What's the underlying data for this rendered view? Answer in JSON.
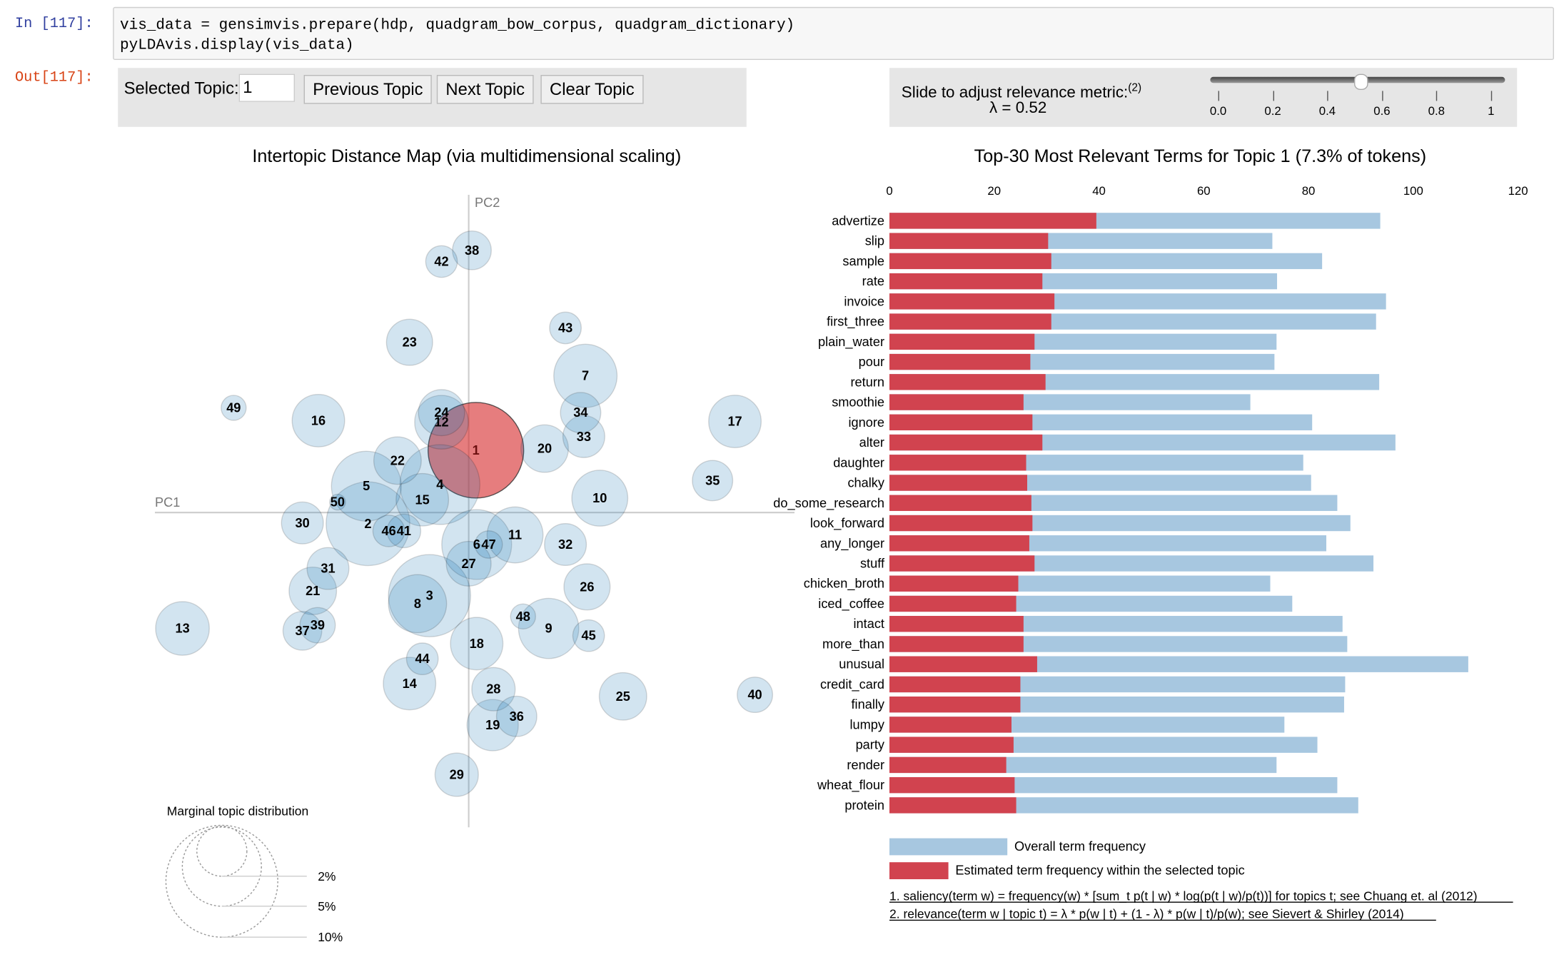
{
  "notebook": {
    "in_prompt": "In [117]:",
    "out_prompt": "Out[117]:",
    "code_lines": [
      "vis_data = gensimvis.prepare(hdp, quadgram_bow_corpus, quadgram_dictionary)",
      "pyLDAvis.display(vis_data)"
    ]
  },
  "controls": {
    "selected_topic_label": "Selected Topic:",
    "selected_topic_value": "1",
    "previous_label": "Previous Topic",
    "next_label": "Next Topic",
    "clear_label": "Clear Topic"
  },
  "slider": {
    "label": "Slide to adjust relevance metric:",
    "footnote_ref": "(2)",
    "lambda_text": "λ = 0.52",
    "value": 0.52,
    "ticks": [
      "0.0",
      "0.2",
      "0.4",
      "0.6",
      "0.8",
      "1"
    ]
  },
  "colors": {
    "topic_fill": "#1f77b4",
    "selected_topic_fill": "#d62728",
    "overall_bar": "#a7c7e0",
    "topic_bar": "#d1434f"
  },
  "chart_data": [
    {
      "type": "scatter",
      "title": "Intertopic Distance Map (via multidimensional scaling)",
      "xlabel": "PC1",
      "ylabel": "PC2",
      "selected_topic": 1,
      "size_legend": {
        "title": "Marginal topic distribution",
        "levels": [
          {
            "label": "2%",
            "value": 2
          },
          {
            "label": "5%",
            "value": 5
          },
          {
            "label": "10%",
            "value": 10
          }
        ]
      },
      "topics": [
        {
          "id": "1",
          "pc1": 0.009,
          "pc2": 0.078,
          "pct": 7.3
        },
        {
          "id": "2",
          "pc1": -0.126,
          "pc2": -0.014,
          "pct": 5.6
        },
        {
          "id": "3",
          "pc1": -0.049,
          "pc2": -0.104,
          "pct": 5.4
        },
        {
          "id": "4",
          "pc1": -0.036,
          "pc2": 0.035,
          "pct": 5.1
        },
        {
          "id": "5",
          "pc1": -0.128,
          "pc2": 0.033,
          "pct": 3.9
        },
        {
          "id": "6",
          "pc1": 0.01,
          "pc2": -0.04,
          "pct": 3.9
        },
        {
          "id": "7",
          "pc1": 0.146,
          "pc2": 0.171,
          "pct": 3.2
        },
        {
          "id": "8",
          "pc1": -0.064,
          "pc2": -0.114,
          "pct": 2.7
        },
        {
          "id": "9",
          "pc1": 0.1,
          "pc2": -0.145,
          "pct": 2.9
        },
        {
          "id": "10",
          "pc1": 0.164,
          "pc2": 0.018,
          "pct": 2.5
        },
        {
          "id": "11",
          "pc1": 0.058,
          "pc2": -0.028,
          "pct": 2.5
        },
        {
          "id": "12",
          "pc1": -0.034,
          "pc2": 0.113,
          "pct": 2.3
        },
        {
          "id": "13",
          "pc1": -0.358,
          "pc2": -0.145,
          "pct": 2.3
        },
        {
          "id": "14",
          "pc1": -0.074,
          "pc2": -0.214,
          "pct": 2.2
        },
        {
          "id": "15",
          "pc1": -0.058,
          "pc2": 0.016,
          "pct": 2.2
        },
        {
          "id": "16",
          "pc1": -0.188,
          "pc2": 0.115,
          "pct": 2.2
        },
        {
          "id": "17",
          "pc1": 0.333,
          "pc2": 0.114,
          "pct": 2.2
        },
        {
          "id": "18",
          "pc1": 0.01,
          "pc2": -0.164,
          "pct": 2.2
        },
        {
          "id": "19",
          "pc1": 0.03,
          "pc2": -0.266,
          "pct": 2.1
        },
        {
          "id": "20",
          "pc1": 0.095,
          "pc2": 0.08,
          "pct": 1.8
        },
        {
          "id": "21",
          "pc1": -0.195,
          "pc2": -0.098,
          "pct": 1.8
        },
        {
          "id": "22",
          "pc1": -0.089,
          "pc2": 0.065,
          "pct": 1.8
        },
        {
          "id": "23",
          "pc1": -0.074,
          "pc2": 0.213,
          "pct": 1.7
        },
        {
          "id": "24",
          "pc1": -0.034,
          "pc2": 0.125,
          "pct": 1.7
        },
        {
          "id": "25",
          "pc1": 0.193,
          "pc2": -0.23,
          "pct": 1.8
        },
        {
          "id": "26",
          "pc1": 0.148,
          "pc2": -0.093,
          "pct": 1.7
        },
        {
          "id": "27",
          "pc1": 0.0,
          "pc2": -0.064,
          "pct": 1.6
        },
        {
          "id": "28",
          "pc1": 0.031,
          "pc2": -0.221,
          "pct": 1.5
        },
        {
          "id": "29",
          "pc1": -0.015,
          "pc2": -0.328,
          "pct": 1.5
        },
        {
          "id": "30",
          "pc1": -0.208,
          "pc2": -0.013,
          "pct": 1.4
        },
        {
          "id": "31",
          "pc1": -0.176,
          "pc2": -0.07,
          "pct": 1.4
        },
        {
          "id": "32",
          "pc1": 0.121,
          "pc2": -0.04,
          "pct": 1.4
        },
        {
          "id": "33",
          "pc1": 0.144,
          "pc2": 0.095,
          "pct": 1.4
        },
        {
          "id": "34",
          "pc1": 0.14,
          "pc2": 0.125,
          "pct": 1.3
        },
        {
          "id": "35",
          "pc1": 0.305,
          "pc2": 0.04,
          "pct": 1.3
        },
        {
          "id": "36",
          "pc1": 0.06,
          "pc2": -0.255,
          "pct": 1.3
        },
        {
          "id": "37",
          "pc1": -0.208,
          "pc2": -0.148,
          "pct": 1.2
        },
        {
          "id": "38",
          "pc1": 0.004,
          "pc2": 0.328,
          "pct": 1.2
        },
        {
          "id": "39",
          "pc1": -0.189,
          "pc2": -0.141,
          "pct": 1.0
        },
        {
          "id": "40",
          "pc1": 0.358,
          "pc2": -0.228,
          "pct": 1.0
        },
        {
          "id": "41",
          "pc1": -0.081,
          "pc2": -0.023,
          "pct": 0.9
        },
        {
          "id": "42",
          "pc1": -0.034,
          "pc2": 0.314,
          "pct": 0.8
        },
        {
          "id": "43",
          "pc1": 0.121,
          "pc2": 0.231,
          "pct": 0.8
        },
        {
          "id": "44",
          "pc1": -0.058,
          "pc2": -0.183,
          "pct": 0.8
        },
        {
          "id": "45",
          "pc1": 0.15,
          "pc2": -0.154,
          "pct": 0.8
        },
        {
          "id": "46",
          "pc1": -0.1,
          "pc2": -0.023,
          "pct": 0.8
        },
        {
          "id": "47",
          "pc1": 0.025,
          "pc2": -0.04,
          "pct": 0.6
        },
        {
          "id": "48",
          "pc1": 0.068,
          "pc2": -0.13,
          "pct": 0.5
        },
        {
          "id": "49",
          "pc1": -0.294,
          "pc2": 0.131,
          "pct": 0.5
        },
        {
          "id": "50",
          "pc1": -0.164,
          "pc2": 0.013,
          "pct": 0.2
        }
      ]
    },
    {
      "type": "bar",
      "orientation": "horizontal",
      "title": "Top-30 Most Relevant Terms for Topic 1 (7.3% of tokens)",
      "xlim": [
        0,
        120
      ],
      "xticks": [
        "0",
        "20",
        "40",
        "60",
        "80",
        "100",
        "120"
      ],
      "categories": [
        "advertize",
        "slip",
        "sample",
        "rate",
        "invoice",
        "first_three",
        "plain_water",
        "pour",
        "return",
        "smoothie",
        "ignore",
        "alter",
        "daughter",
        "chalky",
        "do_some_research",
        "look_forward",
        "any_longer",
        "stuff",
        "chicken_broth",
        "iced_coffee",
        "intact",
        "more_than",
        "unusual",
        "credit_card",
        "finally",
        "lumpy",
        "party",
        "render",
        "wheat_flour",
        "protein"
      ],
      "series": [
        {
          "name": "Overall term frequency",
          "values": [
            93.7,
            73.1,
            82.6,
            74.0,
            94.8,
            92.9,
            73.9,
            73.5,
            93.5,
            68.9,
            80.7,
            96.6,
            79.0,
            80.5,
            85.5,
            88.0,
            83.4,
            92.4,
            72.7,
            76.9,
            86.5,
            87.4,
            110.5,
            87.0,
            86.8,
            75.4,
            81.7,
            73.9,
            85.5,
            89.5
          ]
        },
        {
          "name": "Estimated term frequency within the selected topic",
          "values": [
            39.5,
            30.3,
            30.9,
            29.2,
            31.5,
            30.9,
            27.7,
            26.9,
            29.8,
            25.6,
            27.3,
            29.2,
            26.1,
            26.3,
            27.1,
            27.3,
            26.7,
            27.7,
            24.6,
            24.2,
            25.6,
            25.6,
            28.2,
            25.0,
            25.0,
            23.3,
            23.7,
            22.3,
            23.9,
            24.2
          ]
        }
      ],
      "footnotes": [
        "1. saliency(term w) = frequency(w) * [sum_t p(t | w) * log(p(t | w)/p(t))] for topics t; see Chuang et. al (2012)",
        "2. relevance(term w | topic t) = λ * p(w | t) + (1 - λ) * p(w | t)/p(w); see Sievert & Shirley (2014)"
      ]
    }
  ]
}
